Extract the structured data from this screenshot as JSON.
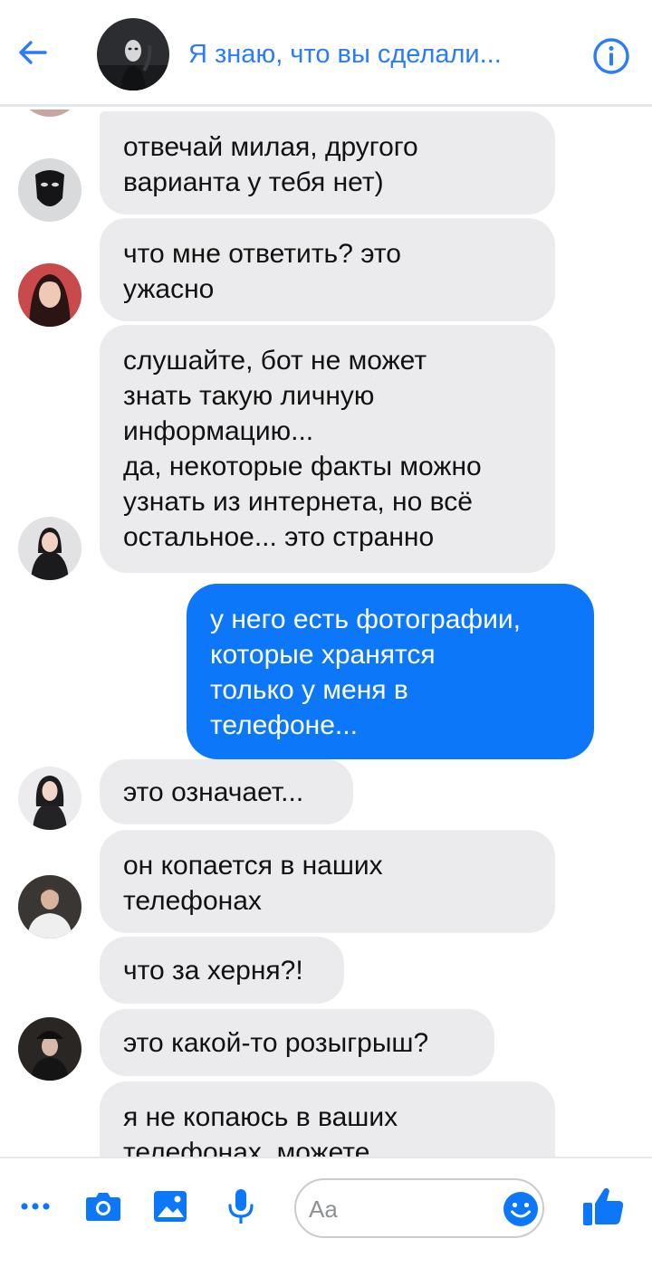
{
  "header": {
    "title": "Я знаю, что вы сделали...",
    "back_icon": "arrow-left-icon",
    "info_icon": "info-icon",
    "accent_color": "#2a7cf7"
  },
  "messages": [
    {
      "sender": "mask",
      "text": [
        "отвечай милая, другого",
        "варианта у тебя нет)"
      ]
    },
    {
      "sender": "girl-red",
      "text": [
        "что мне ответить? это",
        "ужасно"
      ]
    },
    {
      "sender": "girl-black",
      "text": [
        "слушайте, бот не может",
        "знать такую личную",
        "информацию...",
        "да, некоторые факты можно",
        "узнать из интернета, но всё",
        "остальное... это странно"
      ]
    },
    {
      "sender": "me",
      "text": [
        "у него есть фотографии,",
        "которые хранятся",
        "только у меня в",
        "телефоне..."
      ]
    },
    {
      "sender": "girl-dark-hair",
      "text": [
        "это означает..."
      ]
    },
    {
      "sender": "guy",
      "text": [
        "он копается в наших",
        "телефонах"
      ]
    },
    {
      "sender": "guy",
      "text": [
        "что за херня?!"
      ]
    },
    {
      "sender": "girl-hat",
      "text": [
        "это какой-то розыгрыш?"
      ]
    },
    {
      "sender": "unknown",
      "text": [
        "я не копаюсь в ваших",
        "телефонах, можете"
      ]
    }
  ],
  "colors": {
    "incoming_bubble": "#ebebed",
    "outgoing_bubble": "#0c78f9",
    "icon_blue": "#0c78f9"
  },
  "composer": {
    "placeholder": "Aa",
    "icons": [
      "more-icon",
      "camera-icon",
      "image-icon",
      "microphone-icon",
      "emoji-icon",
      "thumbs-up-icon"
    ]
  }
}
